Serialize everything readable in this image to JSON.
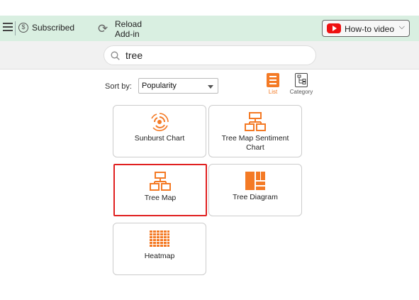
{
  "toolbar": {
    "subscribed_label": "Subscribed",
    "subscribed_icon": "dollar-circle-icon",
    "reload_label_1": "Reload",
    "reload_label_2": "Add-in",
    "howto_label": "How-to video"
  },
  "search": {
    "value": "tree"
  },
  "sort": {
    "label": "Sort by:",
    "selected": "Popularity"
  },
  "views": {
    "list_label": "List",
    "category_label": "Category"
  },
  "cards": [
    {
      "label": "Sunburst Chart",
      "icon": "sunburst-icon"
    },
    {
      "label": "Tree Map Sentiment Chart",
      "icon": "tree-sentiment-icon"
    },
    {
      "label": "Tree Map",
      "icon": "tree-map-icon",
      "selected": true
    },
    {
      "label": "Tree Diagram",
      "icon": "tree-diagram-icon"
    },
    {
      "label": "Heatmap",
      "icon": "heatmap-icon"
    }
  ],
  "colors": {
    "accent": "#f47a25",
    "toolbar_bg": "#d9efe1",
    "selected_border": "#e02020"
  }
}
